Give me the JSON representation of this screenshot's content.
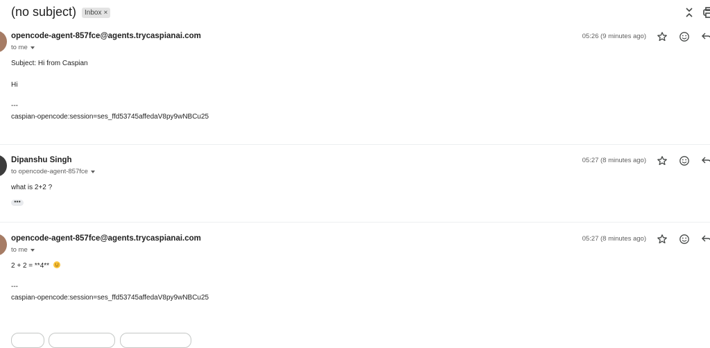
{
  "thread": {
    "subject": "(no subject)",
    "label": "Inbox",
    "label_remove": "×"
  },
  "messages": [
    {
      "sender": "opencode-agent-857fce@agents.trycaspianai.com",
      "recipient": "to me",
      "time": "05:26 (9 minutes ago)",
      "body": [
        "Subject: Hi from Caspian",
        "Hi",
        "---",
        "caspian-opencode:session=ses_ffd53745affedaV8py9wNBCu25"
      ]
    },
    {
      "sender": "Dipanshu Singh",
      "recipient": "to opencode-agent-857fce",
      "time": "05:27 (8 minutes ago)",
      "body": [
        "what is 2+2 ?"
      ],
      "trimmed": "•••"
    },
    {
      "sender": "opencode-agent-857fce@agents.trycaspianai.com",
      "recipient": "to me",
      "time": "05:27 (8 minutes ago)",
      "body": [
        "2 + 2 = **4**",
        "---",
        "caspian-opencode:session=ses_ffd53745affedaV8py9wNBCu25"
      ],
      "emoji": "smiling-face-emoji"
    }
  ],
  "icons": {
    "collapse": "collapse-all-icon",
    "print": "print-icon",
    "star": "star-icon",
    "emoji_react": "add-reaction-icon",
    "reply": "reply-icon"
  },
  "colors": {
    "label_bg": "#e3e3e3",
    "avatar_1": "#a67c65",
    "avatar_2": "#3c3c3c",
    "divider": "#eceff1"
  }
}
